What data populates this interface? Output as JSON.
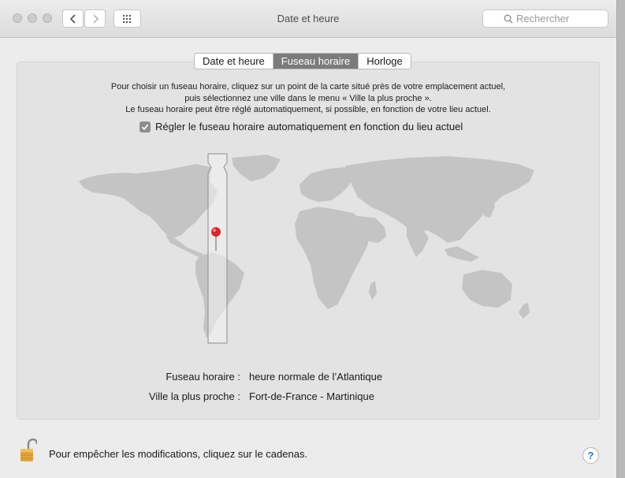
{
  "window": {
    "title": "Date et heure",
    "search_placeholder": "Rechercher"
  },
  "tabs": [
    {
      "label": "Date et heure",
      "active": false
    },
    {
      "label": "Fuseau horaire",
      "active": true
    },
    {
      "label": "Horloge",
      "active": false
    }
  ],
  "instructions": {
    "line1": "Pour choisir un fuseau horaire, cliquez sur un point de la carte situé près de votre emplacement actuel,",
    "line2": "puis sélectionnez une ville dans le menu « Ville la plus proche ».",
    "line3": "Le fuseau horaire peut être réglé automatiquement, si possible, en fonction de votre lieu actuel."
  },
  "auto_timezone": {
    "label": "Régler le fuseau horaire automatiquement en fonction du lieu actuel",
    "checked": true
  },
  "timezone": {
    "label": "Fuseau horaire :",
    "value": "heure normale de l’Atlantique"
  },
  "closest_city": {
    "label": "Ville la plus proche :",
    "value": "Fort-de-France - Martinique"
  },
  "footer": {
    "lock_text": "Pour empêcher les modifications, cliquez sur le cadenas.",
    "help_label": "?"
  },
  "colors": {
    "pin": "#d8262b",
    "lock": "#e2a43a",
    "map_land": "#c4c4c4",
    "highlight_band": "#f0f0f0",
    "tab_active": "#7b7b7b"
  }
}
